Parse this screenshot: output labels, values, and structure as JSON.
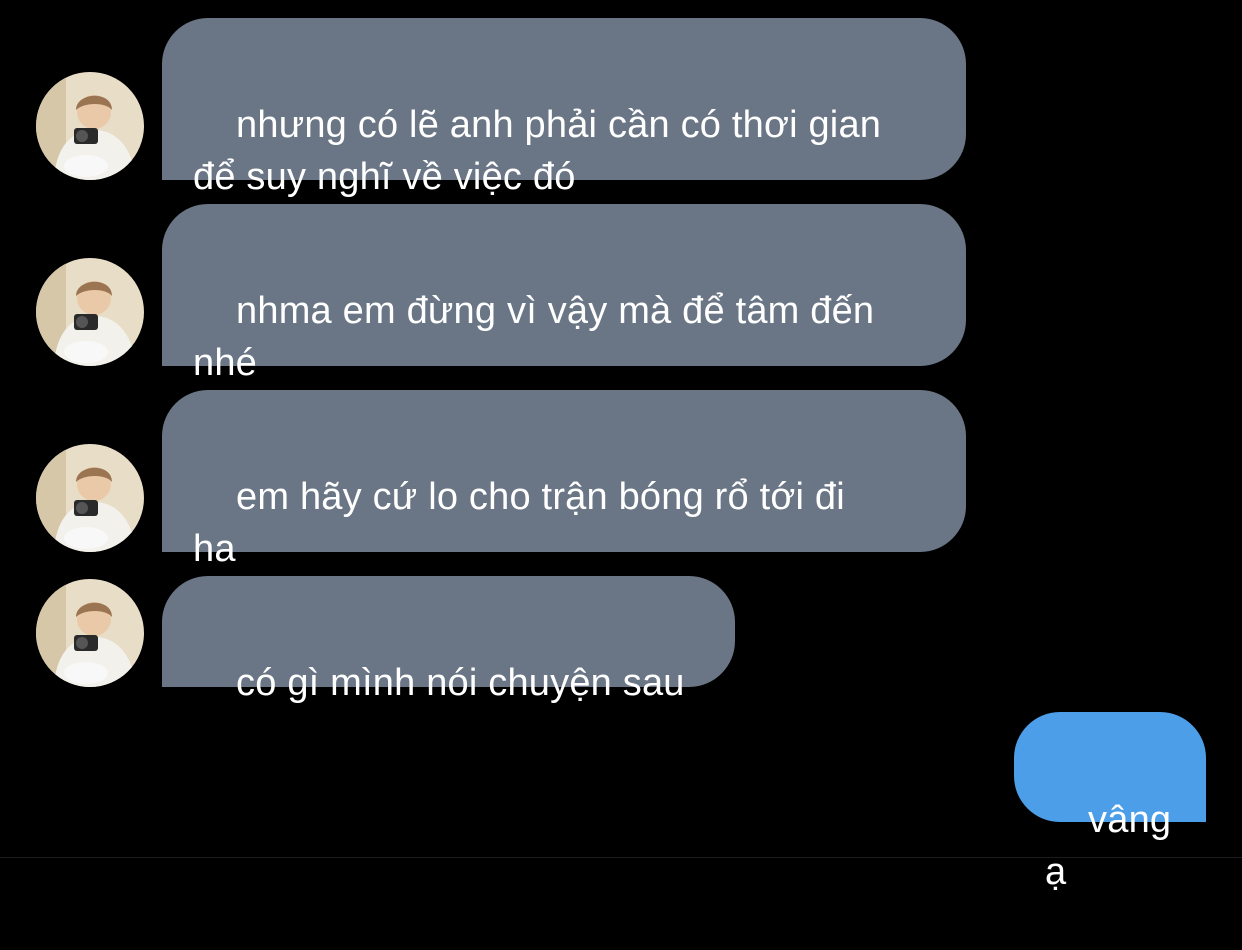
{
  "colors": {
    "background": "#000000",
    "incoming_bubble": "#6a7685",
    "outgoing_bubble": "#4d9ee8",
    "text": "#ffffff"
  },
  "messages": [
    {
      "direction": "incoming",
      "avatar": "avatar-photo-icon",
      "text": "nhưng có lẽ anh phải cần có thơi gian\nđể suy nghĩ về việc đó"
    },
    {
      "direction": "incoming",
      "avatar": "avatar-photo-icon",
      "text": "nhma em đừng vì vậy mà để tâm đến\nnhé"
    },
    {
      "direction": "incoming",
      "avatar": "avatar-photo-icon",
      "text": "em hãy cứ lo cho trận bóng rổ tới đi\nha"
    },
    {
      "direction": "incoming",
      "avatar": "avatar-photo-icon",
      "text": "có gì mình nói chuyện sau"
    },
    {
      "direction": "outgoing",
      "text": "vâng ạ"
    }
  ]
}
